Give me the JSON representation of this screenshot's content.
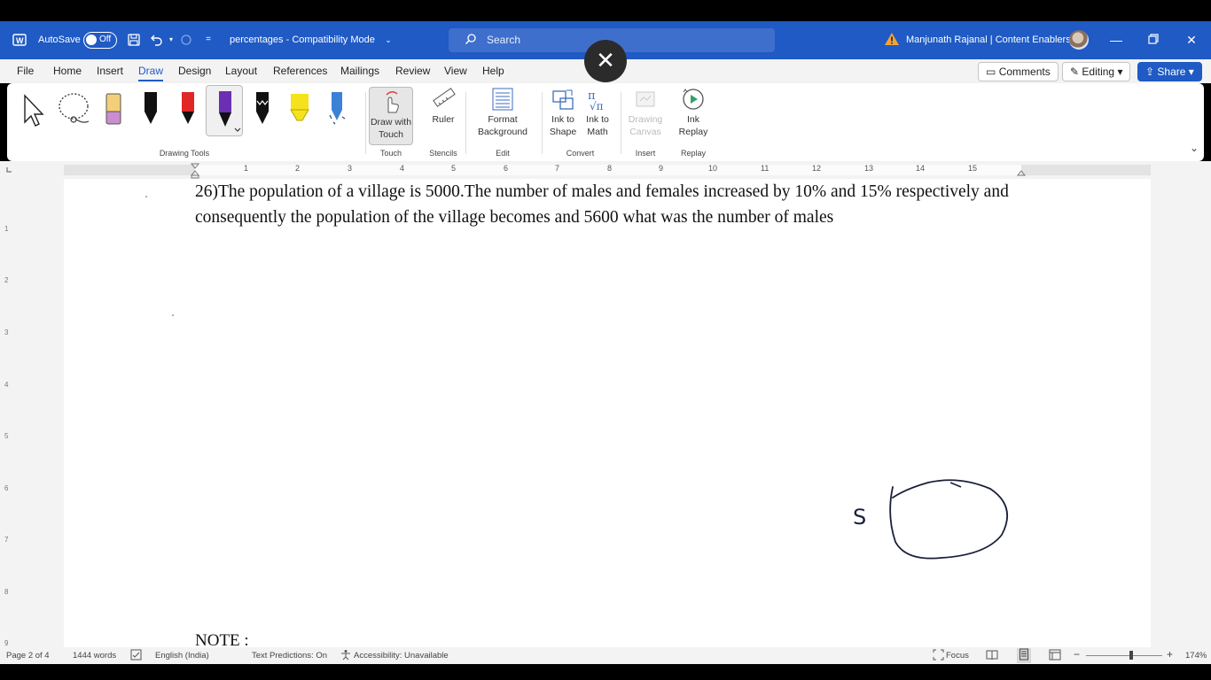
{
  "titlebar": {
    "autosave_label": "AutoSave",
    "autosave_state": "Off",
    "doc_title": "percentages  -  Compatibility Mode",
    "search_placeholder": "Search",
    "user": "Manjunath Rajanal | Content Enablers",
    "bg_color": "#1f5ac5"
  },
  "menu": {
    "tabs": [
      "File",
      "Home",
      "Insert",
      "Draw",
      "Design",
      "Layout",
      "References",
      "Mailings",
      "Review",
      "View",
      "Help"
    ],
    "active_tab": "Draw",
    "comments": "Comments",
    "editing": "Editing",
    "share": "Share"
  },
  "ribbon": {
    "groups": {
      "drawing_tools": "Drawing Tools",
      "touch": "Touch",
      "stencils": "Stencils",
      "edit": "Edit",
      "convert": "Convert",
      "insert": "Insert",
      "replay": "Replay"
    },
    "items": {
      "draw_with_touch": [
        "Draw with",
        "Touch"
      ],
      "ruler": "Ruler",
      "format_background": [
        "Format",
        "Background"
      ],
      "ink_to_shape": [
        "Ink to",
        "Shape"
      ],
      "ink_to_math": [
        "Ink to",
        "Math"
      ],
      "drawing_canvas": [
        "Drawing",
        "Canvas"
      ],
      "ink_replay": [
        "Ink",
        "Replay"
      ]
    }
  },
  "ruler": {
    "numbers": [
      "1",
      "2",
      "3",
      "4",
      "5",
      "6",
      "7",
      "8",
      "9",
      "10",
      "11",
      "12",
      "13",
      "14",
      "15"
    ],
    "vertical_numbers": [
      "1",
      "2",
      "3",
      "4",
      "5",
      "6",
      "7",
      "8",
      "9"
    ]
  },
  "document": {
    "question": "26)The population of a village is 5000.The number of males and females increased by 10% and 15% respectively and consequently the population of the village becomes and 5600 what was the number of males",
    "note": "NOTE :",
    "ink_letter": "S"
  },
  "status": {
    "page": "Page 2 of 4",
    "words": "1444 words",
    "language": "English (India)",
    "predictions": "Text Predictions: On",
    "accessibility": "Accessibility: Unavailable",
    "focus": "Focus",
    "zoom": "174%"
  }
}
